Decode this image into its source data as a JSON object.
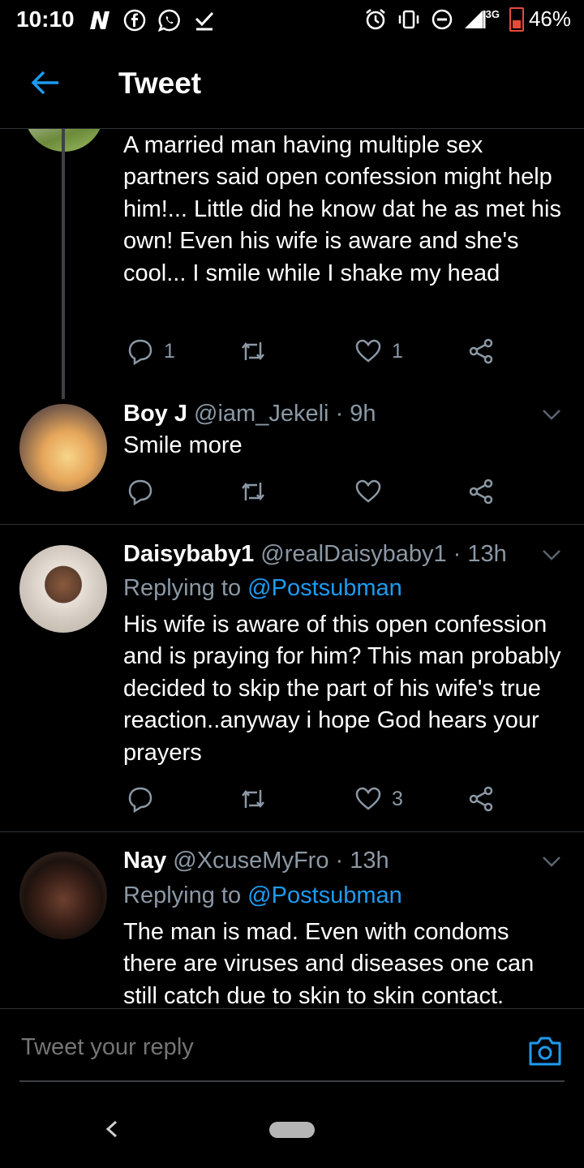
{
  "status_bar": {
    "time": "10:10",
    "network": "3G",
    "battery": "46%"
  },
  "app_bar": {
    "title": "Tweet"
  },
  "tweets": [
    {
      "text": "A married man having multiple sex partners said open confession might help him!... Little did he know dat he as met his own! Even his wife is aware and she's cool... I smile while I shake my head",
      "reply_count": "1",
      "like_count": "1"
    },
    {
      "name": "Boy J",
      "handle": "@iam_Jekeli",
      "time": "· 9h",
      "text": "Smile more",
      "reply_count": "",
      "like_count": ""
    },
    {
      "name": "Daisybaby1",
      "handle": "@realDaisybaby1",
      "time": "· 13h",
      "replying_prefix": "Replying to ",
      "replying_to": "@Postsubman",
      "text": "His wife is aware of this open confession and is praying for him? This man probably decided to skip the part of his wife's true reaction..anyway i hope God hears your prayers",
      "reply_count": "",
      "like_count": "3"
    },
    {
      "name": "Nay",
      "handle": "@XcuseMyFro",
      "time": "· 13h",
      "replying_prefix": "Replying to ",
      "replying_to": "@Postsubman",
      "text": "The man is mad. Even with condoms there are viruses and diseases one can still catch due to skin to skin contact."
    }
  ],
  "composer": {
    "placeholder": "Tweet your reply"
  },
  "colors": {
    "accent": "#1d9bf0",
    "muted": "#8b98a5",
    "background": "#000000",
    "divider": "#2f3336"
  }
}
